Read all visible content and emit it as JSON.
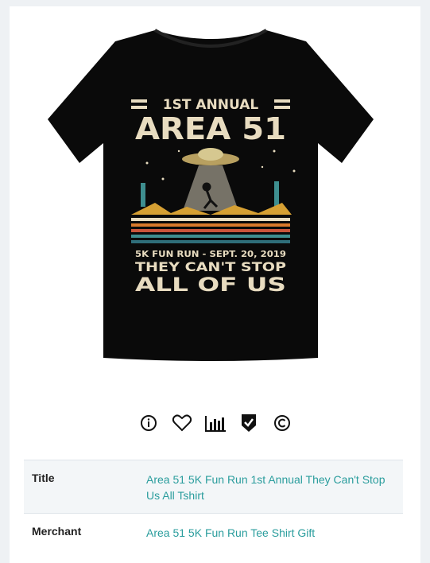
{
  "product": {
    "shirt_color": "#0a0a0a",
    "print": {
      "line1": "1ST ANNUAL",
      "line2": "AREA 51",
      "line3": "5K FUN RUN - SEPT. 20, 2019",
      "line4": "THEY CAN'T STOP",
      "line5": "ALL OF US",
      "text_color": "#e8dcc0",
      "stripe_colors": [
        "#e8dcc0",
        "#d97a2b",
        "#c9553a",
        "#3e8e8f",
        "#2f6e7a"
      ]
    }
  },
  "actions": [
    {
      "name": "info-icon"
    },
    {
      "name": "heart-icon"
    },
    {
      "name": "chart-icon"
    },
    {
      "name": "shield-check-icon"
    },
    {
      "name": "copyright-icon"
    }
  ],
  "details": {
    "rows": [
      {
        "key": "Title",
        "value": "Area 51 5K Fun Run 1st Annual They Can't Stop Us All Tshirt"
      },
      {
        "key": "Merchant",
        "value": "Area 51 5K Fun Run Tee Shirt Gift"
      }
    ]
  },
  "colors": {
    "link": "#2a9d9d",
    "background": "#eef1f4"
  }
}
